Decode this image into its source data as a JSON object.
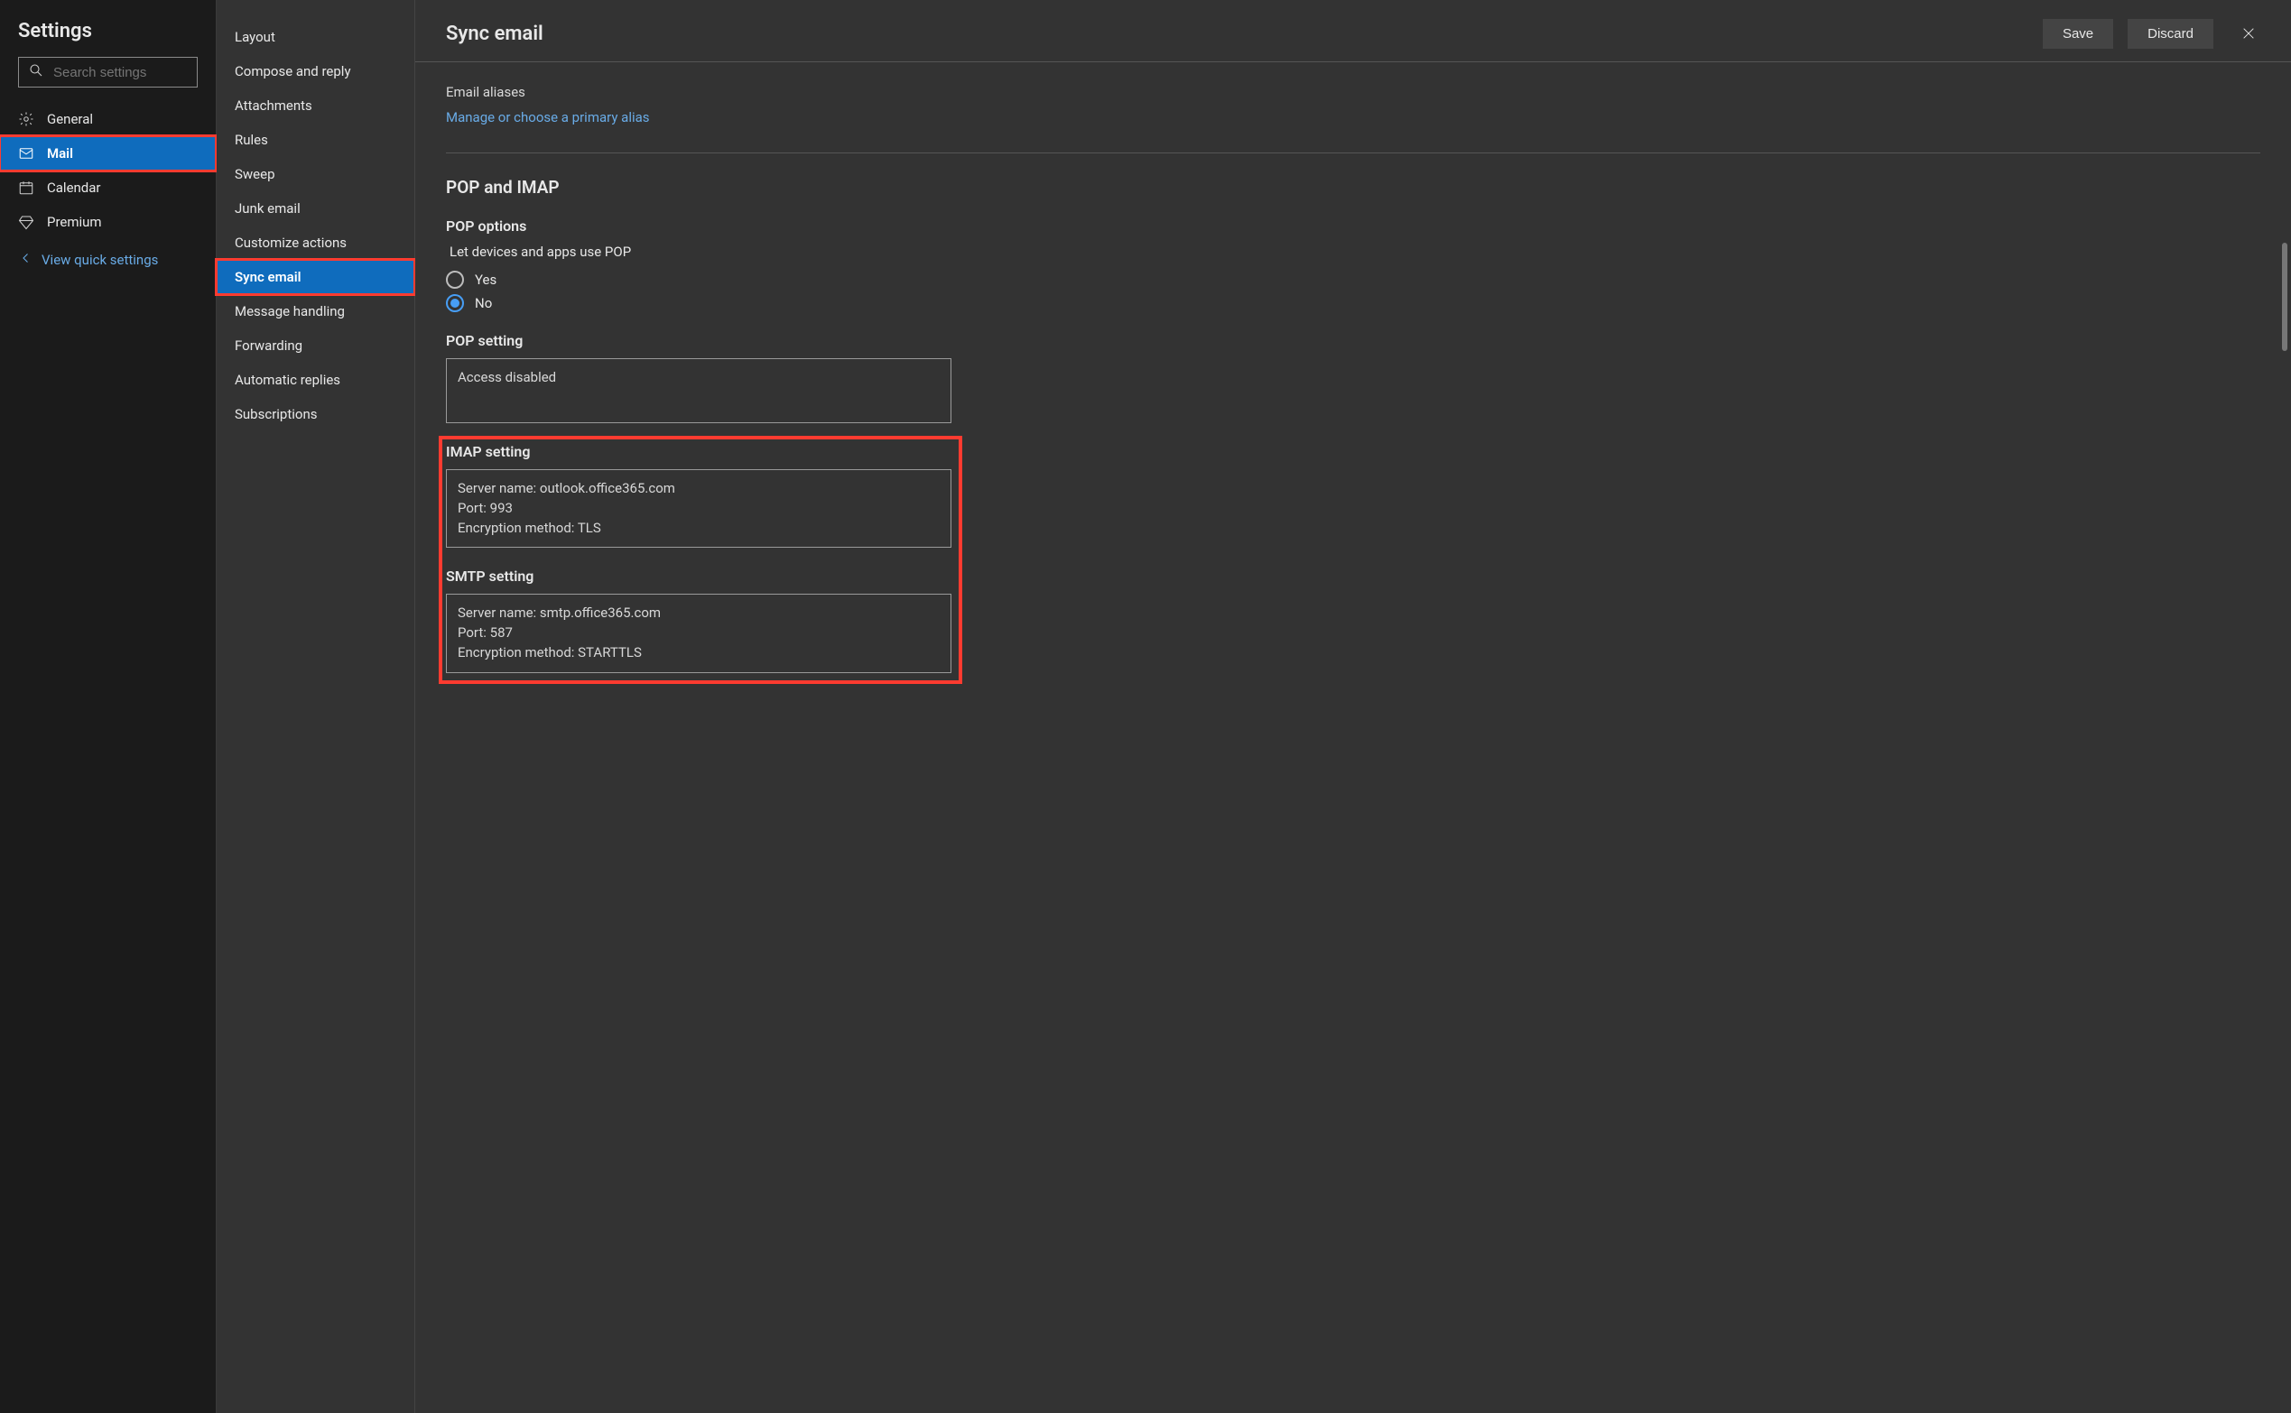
{
  "title": "Settings",
  "search": {
    "placeholder": "Search settings"
  },
  "categories": [
    {
      "id": "general",
      "label": "General",
      "icon": "gear"
    },
    {
      "id": "mail",
      "label": "Mail",
      "icon": "mail",
      "active": true,
      "highlighted": true
    },
    {
      "id": "calendar",
      "label": "Calendar",
      "icon": "calendar"
    },
    {
      "id": "premium",
      "label": "Premium",
      "icon": "diamond"
    }
  ],
  "quick_link": "View quick settings",
  "subitems": [
    {
      "id": "layout",
      "label": "Layout"
    },
    {
      "id": "compose",
      "label": "Compose and reply"
    },
    {
      "id": "attachments",
      "label": "Attachments"
    },
    {
      "id": "rules",
      "label": "Rules"
    },
    {
      "id": "sweep",
      "label": "Sweep"
    },
    {
      "id": "junk",
      "label": "Junk email"
    },
    {
      "id": "customize",
      "label": "Customize actions"
    },
    {
      "id": "sync",
      "label": "Sync email",
      "active": true,
      "highlighted": true
    },
    {
      "id": "message-handling",
      "label": "Message handling"
    },
    {
      "id": "forwarding",
      "label": "Forwarding"
    },
    {
      "id": "auto-replies",
      "label": "Automatic replies"
    },
    {
      "id": "subscriptions",
      "label": "Subscriptions"
    }
  ],
  "main": {
    "heading": "Sync email",
    "save": "Save",
    "discard": "Discard",
    "aliases_label": "Email aliases",
    "aliases_link": "Manage or choose a primary alias",
    "pop_imap_title": "POP and IMAP",
    "pop_options_label": "POP options",
    "pop_toggle_label": "Let devices and apps use POP",
    "radio_yes": "Yes",
    "radio_no": "No",
    "pop_selected": "no",
    "pop_setting_label": "POP setting",
    "pop_setting_value": "Access disabled",
    "imap_label": "IMAP setting",
    "imap_value": "Server name: outlook.office365.com\nPort: 993\nEncryption method: TLS",
    "smtp_label": "SMTP setting",
    "smtp_value": "Server name: smtp.office365.com\nPort: 587\nEncryption method: STARTTLS"
  }
}
